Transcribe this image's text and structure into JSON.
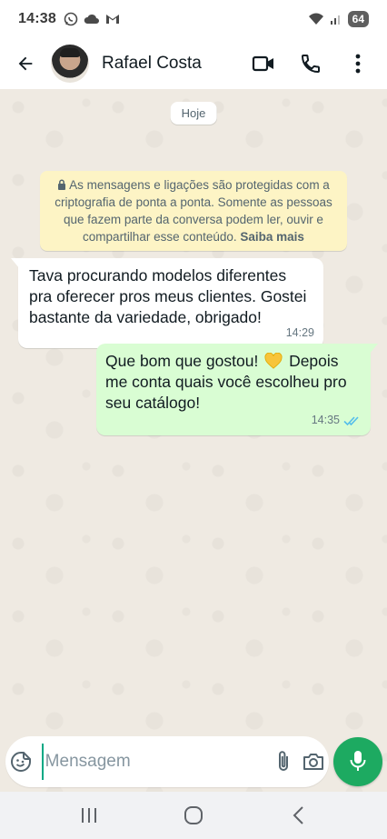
{
  "status_bar": {
    "time": "14:38",
    "battery": "64"
  },
  "header": {
    "contact_name": "Rafael Costa"
  },
  "chat": {
    "date_chip": "Hoje",
    "e2e_notice": "As mensagens e ligações são protegidas com a criptografia de ponta a ponta. Somente as pessoas que fazem parte da conversa podem ler, ouvir e compartilhar esse conteúdo.",
    "e2e_link": "Saiba mais",
    "messages": [
      {
        "direction": "incoming",
        "text": "Tava procurando modelos diferentes pra oferecer pros meus clientes. Gostei bastante da variedade, obrigado!",
        "time": "14:29"
      },
      {
        "direction": "outgoing",
        "text_before_emoji": "Que bom que gostou!",
        "emoji": "yellow-heart",
        "text_after_emoji": "Depois me conta quais você escolheu pro seu catálogo!",
        "time": "14:35",
        "status": "read"
      }
    ]
  },
  "input_bar": {
    "placeholder": "Mensagem"
  },
  "colors": {
    "chat_background": "#efeae2",
    "outgoing_bubble": "#d9fdd3",
    "incoming_bubble": "#ffffff",
    "e2e_notice": "#fdf4c5",
    "mic_button": "#1daa61",
    "read_ticks": "#53bdeb"
  }
}
